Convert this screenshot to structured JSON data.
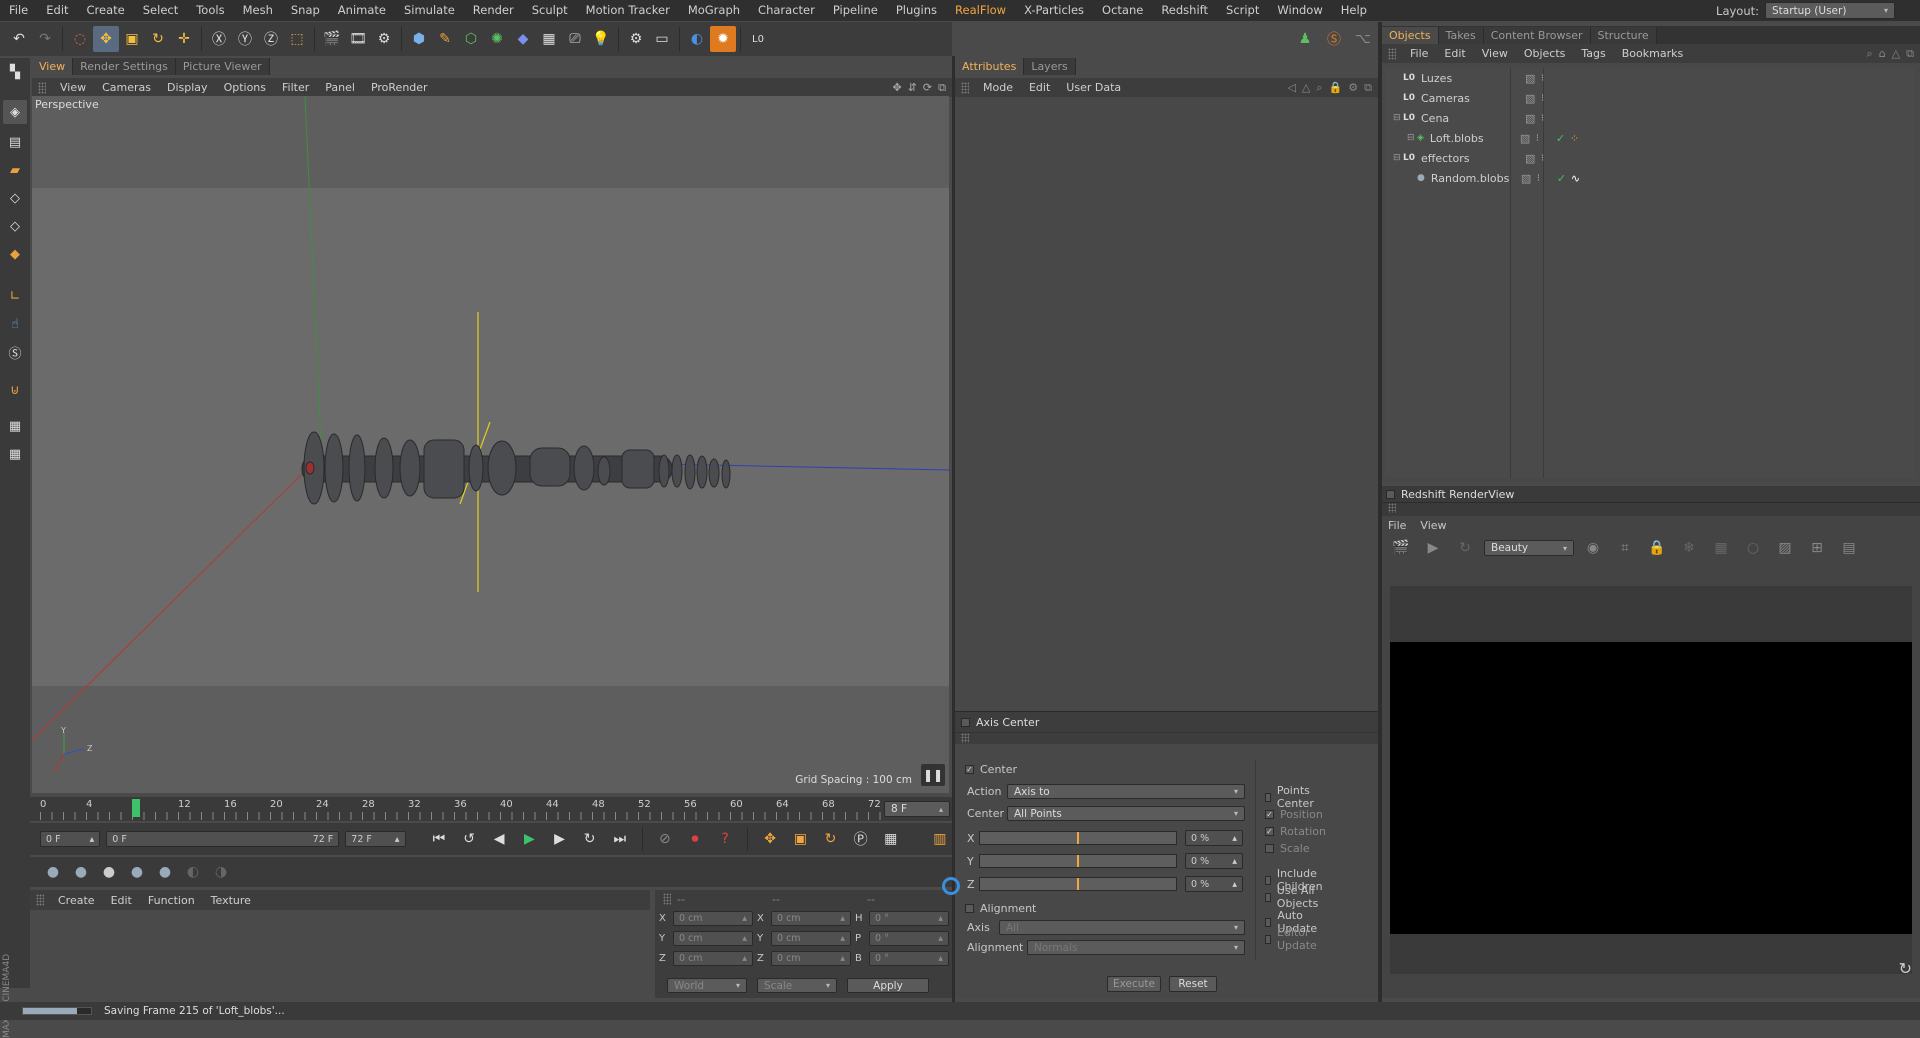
{
  "menubar": {
    "items": [
      "File",
      "Edit",
      "Create",
      "Select",
      "Tools",
      "Mesh",
      "Snap",
      "Animate",
      "Simulate",
      "Render",
      "Sculpt",
      "Motion Tracker",
      "MoGraph",
      "Character",
      "Pipeline",
      "Plugins",
      "RealFlow",
      "X-Particles",
      "Octane",
      "Redshift",
      "Script",
      "Window",
      "Help"
    ],
    "highlight": "RealFlow",
    "layout_label": "Layout:",
    "layout_value": "Startup (User)"
  },
  "viewport": {
    "tabs": [
      "View",
      "Render Settings",
      "Picture Viewer"
    ],
    "menu": [
      "View",
      "Cameras",
      "Display",
      "Options",
      "Filter",
      "Panel",
      "ProRender"
    ],
    "camera_label": "Perspective",
    "grid_spacing": "Grid Spacing : 100 cm",
    "axis_x": "X",
    "axis_y": "Y",
    "axis_z": "Z"
  },
  "timeline": {
    "ticks": [
      "0",
      "4",
      "8",
      "12",
      "16",
      "20",
      "24",
      "28",
      "32",
      "36",
      "40",
      "44",
      "48",
      "52",
      "56",
      "60",
      "64",
      "68",
      "72"
    ],
    "current_frame": "8 F",
    "current_frame_value": 8,
    "frame_max": 72
  },
  "controls": {
    "start_frame": "0 F",
    "range_start": "0 F",
    "range_end": "72 F",
    "end_frame": "72 F"
  },
  "materials": {
    "menu": [
      "Create",
      "Edit",
      "Function",
      "Texture"
    ]
  },
  "coordinates": {
    "headers": [
      "--",
      "--",
      "--"
    ],
    "rows": [
      {
        "a": "X",
        "av": "0 cm",
        "b": "X",
        "bv": "0 cm",
        "c": "H",
        "cv": "0 °"
      },
      {
        "a": "Y",
        "av": "0 cm",
        "b": "Y",
        "bv": "0 cm",
        "c": "P",
        "cv": "0 °"
      },
      {
        "a": "Z",
        "av": "0 cm",
        "b": "Z",
        "bv": "0 cm",
        "c": "B",
        "cv": "0 °"
      }
    ],
    "mode": "World",
    "scale": "Scale",
    "apply": "Apply"
  },
  "attributes": {
    "tabs": [
      "Attributes",
      "Layers"
    ],
    "menu": [
      "Mode",
      "Edit",
      "User Data"
    ]
  },
  "axis_center": {
    "title": "Axis Center",
    "center_label": "Center",
    "action_label": "Action",
    "action_value": "Axis to",
    "center_sel_label": "Center",
    "center_sel_value": "All Points",
    "x_label": "X",
    "x_val": "0 %",
    "y_label": "Y",
    "y_val": "0 %",
    "z_label": "Z",
    "z_val": "0 %",
    "alignment_check": "Alignment",
    "axis_label": "Axis",
    "axis_value": "All",
    "alignment_label": "Alignment",
    "alignment_value": "Normals",
    "right_options": [
      "Points Center",
      "Position",
      "Rotation",
      "Scale",
      "Include Children",
      "Use All Objects",
      "Auto Update",
      "Editor Update"
    ],
    "execute": "Execute",
    "reset": "Reset"
  },
  "objects": {
    "tabs": [
      "Objects",
      "Takes",
      "Content Browser",
      "Structure"
    ],
    "menu": [
      "File",
      "Edit",
      "View",
      "Objects",
      "Tags",
      "Bookmarks"
    ],
    "items": [
      {
        "name": "Luzes",
        "indent": 0
      },
      {
        "name": "Cameras",
        "indent": 0
      },
      {
        "name": "Cena",
        "indent": 0
      },
      {
        "name": "Loft.blobs",
        "indent": 1
      },
      {
        "name": "effectors",
        "indent": 0
      },
      {
        "name": "Random.blobs",
        "indent": 1
      }
    ]
  },
  "redshift": {
    "title": "Redshift RenderView",
    "menu": [
      "File",
      "View"
    ],
    "aov": "Beauty"
  },
  "status": {
    "text": "Saving Frame 215 of 'Loft_blobs'...",
    "progress": 0.8
  },
  "colors": {
    "accent": "#f2a640",
    "active_tab": "#f1b35a",
    "x_axis": "#c03030",
    "y_axis": "#40a040",
    "z_axis": "#3050c0",
    "yellow_axis": "#e0d020"
  }
}
